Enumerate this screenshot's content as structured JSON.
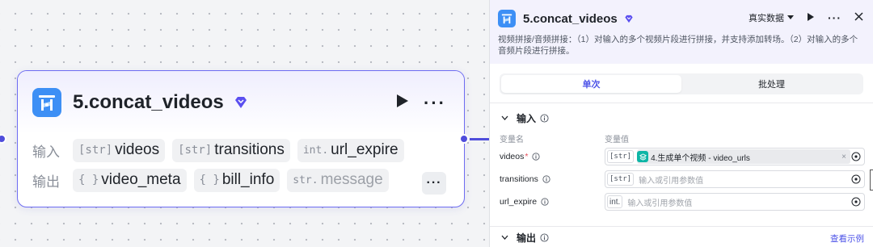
{
  "node": {
    "title": "5.concat_videos",
    "input_label": "输入",
    "output_label": "输出",
    "inputs": [
      {
        "tag": "[str]",
        "name": "videos"
      },
      {
        "tag": "[str]",
        "name": "transitions"
      },
      {
        "tag": "int.",
        "name": "url_expire"
      }
    ],
    "outputs": [
      {
        "tag": "{ }",
        "name": "video_meta"
      },
      {
        "tag": "{ }",
        "name": "bill_info"
      },
      {
        "tag": "str.",
        "name": "message"
      }
    ],
    "more_label": "···"
  },
  "panel": {
    "title": "5.concat_videos",
    "data_mode": "真实数据",
    "description": "视频拼接/音频拼接：（1）对输入的多个视频片段进行拼接，并支持添加转场。（2）对输入的多个音频片段进行拼接。",
    "tabs": [
      {
        "label": "单次",
        "active": true
      },
      {
        "label": "批处理",
        "active": false
      }
    ],
    "input_section": "输入",
    "col_name": "变量名",
    "col_value": "变量值",
    "params": [
      {
        "name": "videos",
        "required": true,
        "tag": "[str]",
        "ref": "4.生成单个视频 - video_urls",
        "placeholder": ""
      },
      {
        "name": "transitions",
        "required": false,
        "tag": "[str]",
        "ref": "",
        "placeholder": "输入或引用参数值"
      },
      {
        "name": "url_expire",
        "required": false,
        "tag": "int.",
        "ref": "",
        "placeholder": "输入或引用参数值"
      }
    ],
    "output_section": "输出",
    "view_example": "查看示例"
  },
  "colors": {
    "accent": "#4d53e8",
    "node_border": "#6d6cf2",
    "icon_blue": "#3d8ff5",
    "ref_teal": "#0db5a6",
    "required": "#e34d59"
  },
  "icons": [
    "video-concat-icon",
    "diamond-icon",
    "play-icon",
    "more-icon",
    "close-icon",
    "chevron-down-icon",
    "info-icon",
    "variable-picker-icon"
  ]
}
